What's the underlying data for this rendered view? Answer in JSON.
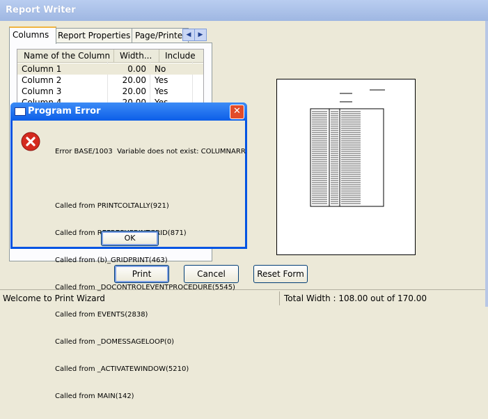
{
  "window": {
    "title": "Report Writer"
  },
  "tabs": [
    "Columns",
    "Report Properties",
    "Page/Printer"
  ],
  "grid": {
    "headers": [
      "Name of the Column",
      "Width...",
      "Include"
    ],
    "rows": [
      {
        "name": "Column 1",
        "width": "0.00",
        "include": "No"
      },
      {
        "name": "Column 2",
        "width": "20.00",
        "include": "Yes"
      },
      {
        "name": "Column 3",
        "width": "20.00",
        "include": "Yes"
      },
      {
        "name": "Column 4",
        "width": "20.00",
        "include": "Yes"
      }
    ]
  },
  "buttons": {
    "print": "Print",
    "cancel": "Cancel",
    "reset": "Reset Form"
  },
  "status": {
    "left": "Welcome to Print Wizard",
    "right": "Total Width : 108.00 out of 170.00"
  },
  "dialog": {
    "title": "Program Error",
    "lines": [
      "Error BASE/1003  Variable does not exist: COLUMNARR",
      "",
      "Called from PRINTCOLTALLY(921)",
      "Called from REFRESHPRINTGRID(871)",
      "Called from (b)_GRIDPRINT(463)",
      "Called from _DOCONTROLEVENTPROCEDURE(5545)",
      "Called from EVENTS(2838)",
      "Called from _DOMESSAGELOOP(0)",
      "Called from _ACTIVATEWINDOW(5210)",
      "Called from MAIN(142)"
    ],
    "ok": "OK"
  },
  "colors": {
    "title_text": "#ffffff",
    "dialog_frame": "#0054e3",
    "close_button": "#e24c2a"
  }
}
